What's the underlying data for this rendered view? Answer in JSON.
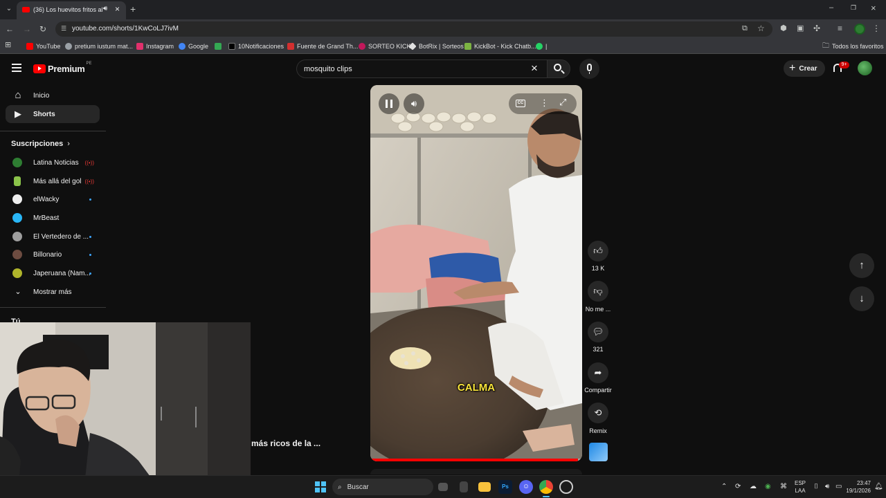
{
  "browser": {
    "tab_title": "(36) Los huevitos fritos al p",
    "url": "youtube.com/shorts/1KwCoLJ7ivM",
    "bookmarks": [
      {
        "label": "YouTube",
        "color": "#ff0000"
      },
      {
        "label": "pretium iustum mat...",
        "color": "#9aa0a6"
      },
      {
        "label": "Instagram",
        "color": "#e1306c"
      },
      {
        "label": "Google",
        "color": "#4285f4"
      },
      {
        "label": "",
        "color": "#34a853"
      },
      {
        "label": "10Notificaciones",
        "color": "#000000"
      },
      {
        "label": "Fuente de Grand Th...",
        "color": "#d32f2f"
      },
      {
        "label": "SORTEO KICK",
        "color": "#c2185b"
      },
      {
        "label": "BotRix | Sorteos",
        "color": "#e0e0e0"
      },
      {
        "label": "KickBot - Kick Chatb...",
        "color": "#7cb342"
      },
      {
        "label": "|",
        "color": "#25d366"
      }
    ],
    "all_bookmarks": "Todos los favoritos"
  },
  "youtube": {
    "logo": "Premium",
    "country": "PE",
    "search_query": "mosquito clips",
    "create_label": "Crear",
    "notif_badge": "9+",
    "sidebar": {
      "main": [
        {
          "label": "Inicio",
          "icon": "home-icon"
        },
        {
          "label": "Shorts",
          "icon": "shorts-icon"
        }
      ],
      "subs_heading": "Suscripciones",
      "subs": [
        {
          "label": "Latina Noticias",
          "live": "((•))",
          "color": "#2e7d32"
        },
        {
          "label": "Más allá del gol",
          "live": "((•))",
          "color": "#8bc34a"
        },
        {
          "label": "elWacky",
          "live": "",
          "color": "#eeeeee"
        },
        {
          "label": "MrBeast",
          "live": "",
          "color": "#29b6f6"
        },
        {
          "label": "El Vertedero de ...",
          "live": "",
          "color": "#9e9e9e"
        },
        {
          "label": "Billonario",
          "live": "",
          "color": "#6d4c41"
        },
        {
          "label": "Japeruana (Nam...",
          "live": "",
          "color": "#afb42b"
        }
      ],
      "show_more": "Mostrar más",
      "you_heading": "Tú"
    },
    "short": {
      "caption": "CALMA",
      "title": "más ricos de la ...",
      "progress": 0.98
    },
    "actions": {
      "like_count": "13 K",
      "dislike_label": "No me ...",
      "comments_count": "321",
      "share_label": "Compartir",
      "remix_label": "Remix"
    }
  },
  "taskbar": {
    "search_label": "Buscar",
    "lang": "ESP",
    "lang2": "LAA",
    "time": "23:47",
    "date": "19/1/2026"
  }
}
